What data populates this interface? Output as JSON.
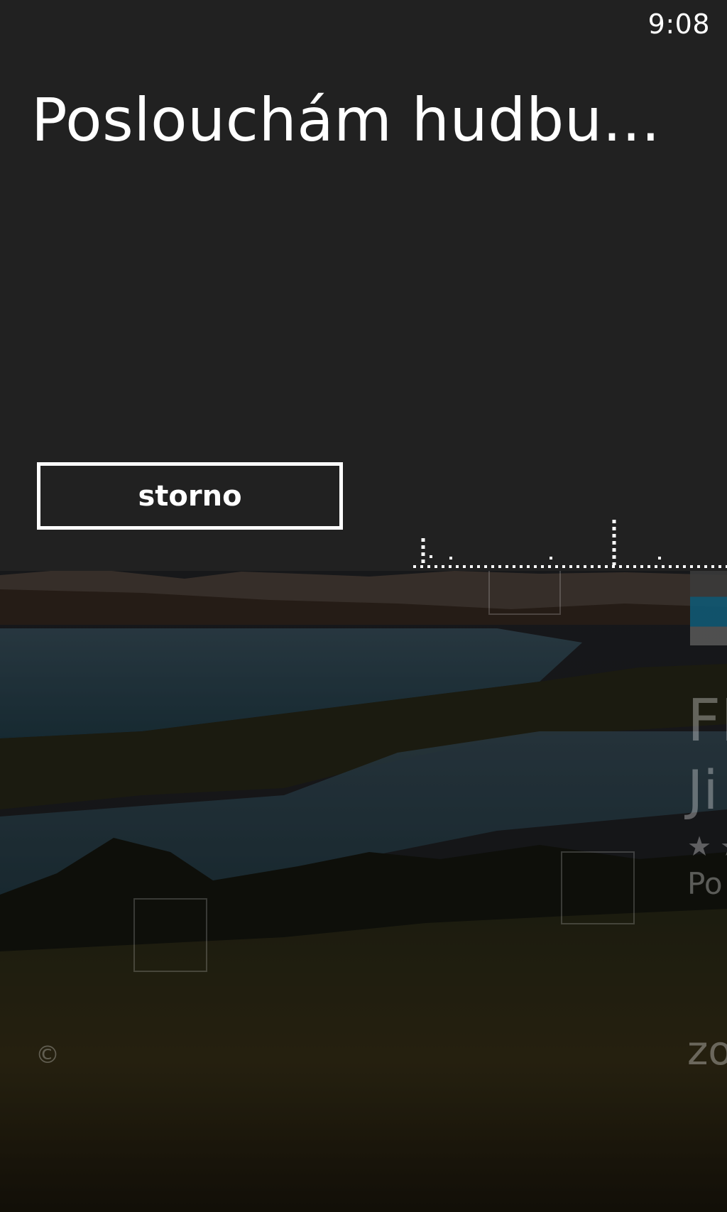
{
  "status_bar": {
    "time": "9:08"
  },
  "listening_panel": {
    "title": "Poslouchám hudbu...",
    "cancel_label": "storno"
  },
  "background_app": {
    "title_partial": "FI",
    "subtitle_partial": "Ji",
    "rating_partial": "★ ★",
    "meta_partial": "Po",
    "link_partial": "zo",
    "copyright_symbol": "©"
  },
  "icons": {
    "listening_visualizer": "audio-visualizer-icon",
    "rating": "star-icon"
  },
  "colors": {
    "panel_background": "#212121",
    "text": "#ffffff",
    "accent": "#0f5874"
  }
}
